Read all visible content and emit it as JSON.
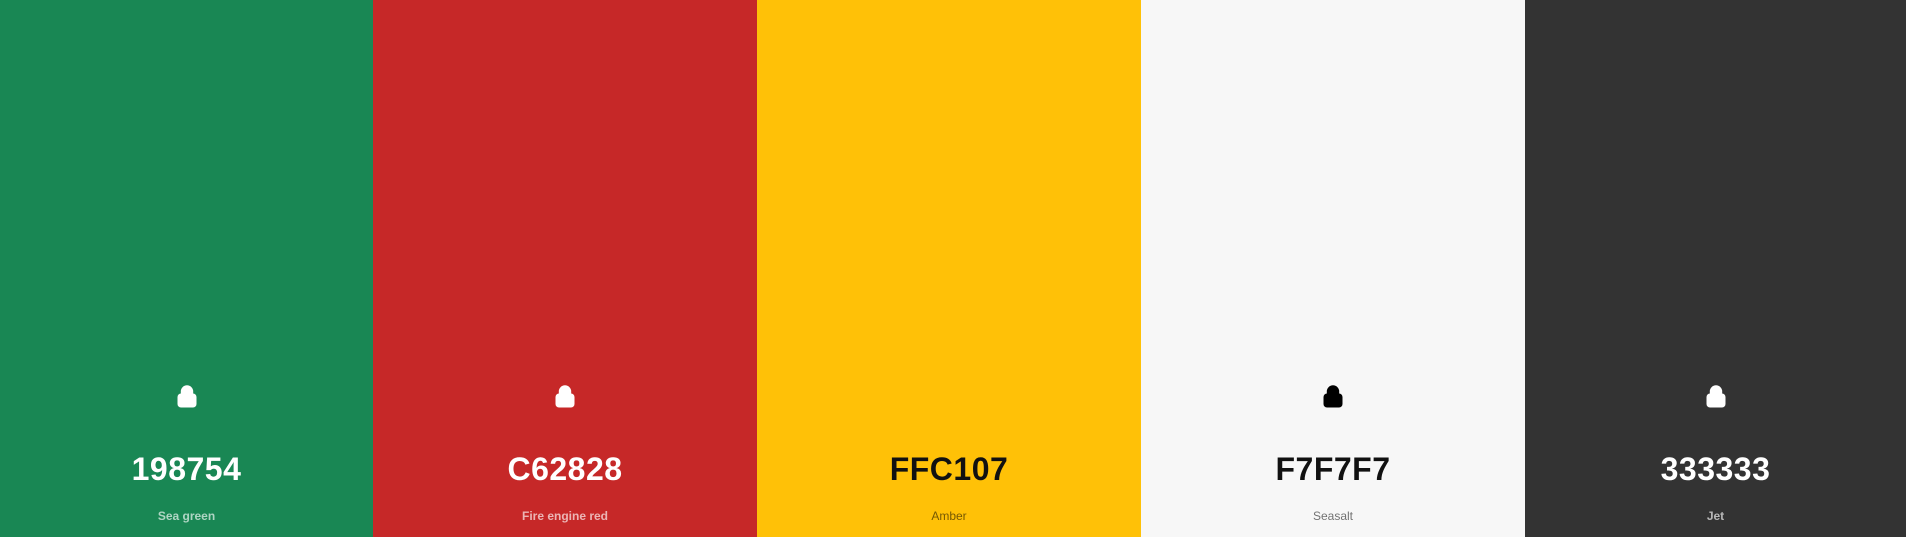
{
  "swatches": [
    {
      "hex": "198754",
      "name": "Sea green",
      "color": "#198754",
      "theme": "light",
      "lock_icon": "lock-icon",
      "lock_visible": true
    },
    {
      "hex": "C62828",
      "name": "Fire engine red",
      "color": "#C62828",
      "theme": "light",
      "lock_icon": "lock-icon",
      "lock_visible": true
    },
    {
      "hex": "FFC107",
      "name": "Amber",
      "color": "#FFC107",
      "theme": "dark",
      "lock_icon": "lock-icon",
      "lock_visible": false
    },
    {
      "hex": "F7F7F7",
      "name": "Seasalt",
      "color": "#F7F7F7",
      "theme": "dark",
      "lock_icon": "lock-icon",
      "lock_visible": true
    },
    {
      "hex": "333333",
      "name": "Jet",
      "color": "#333333",
      "theme": "light",
      "lock_icon": "lock-icon",
      "lock_visible": true
    }
  ]
}
